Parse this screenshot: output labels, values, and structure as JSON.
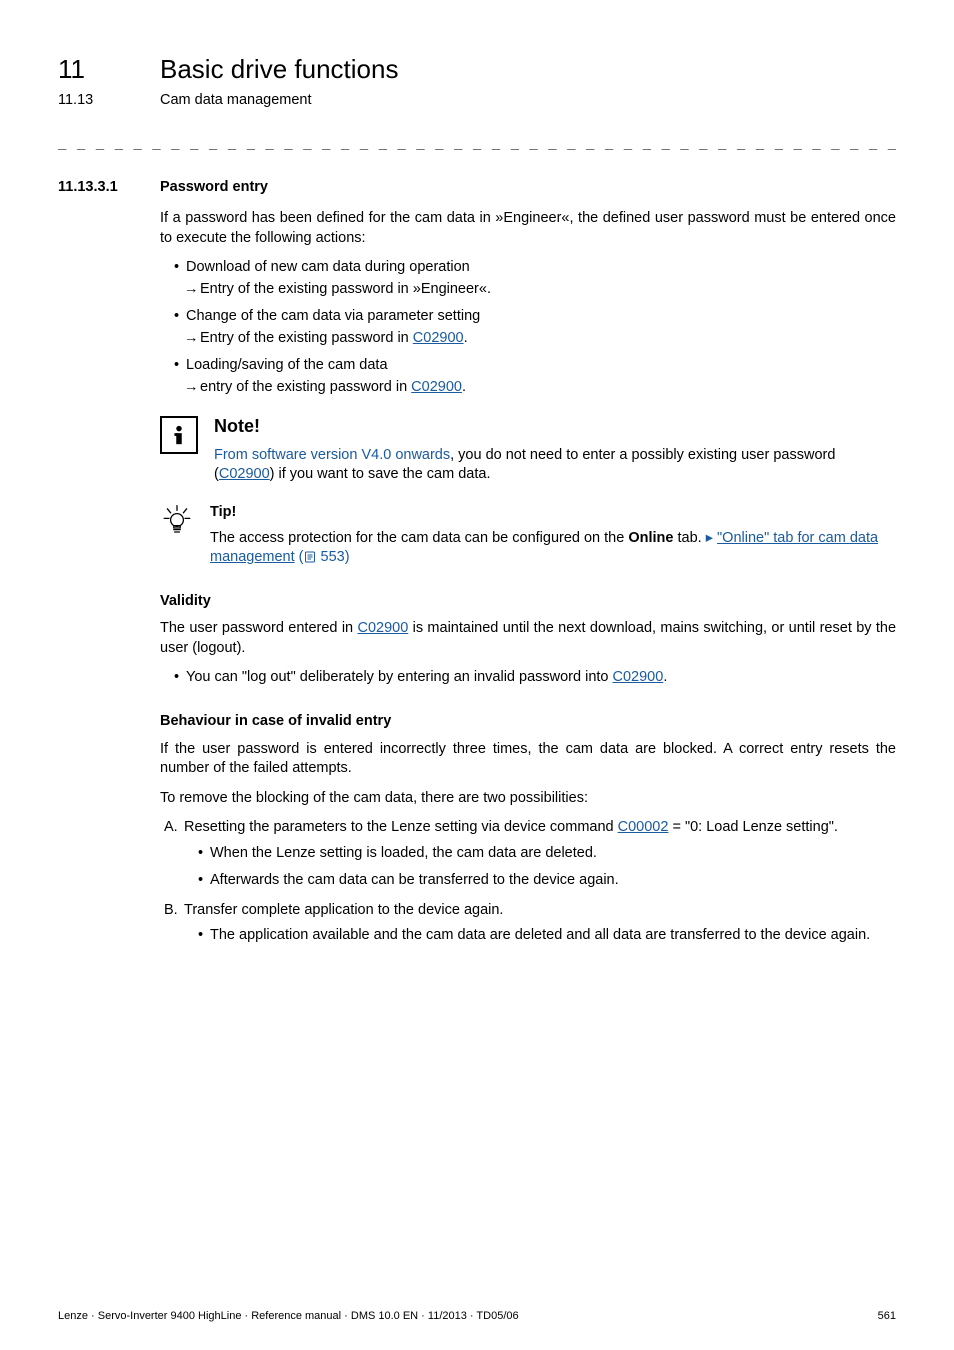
{
  "header": {
    "chapter_num": "11",
    "chapter_title": "Basic drive functions",
    "section_num": "11.13",
    "section_title": "Cam data management"
  },
  "rule": "_ _ _ _ _ _ _ _ _ _ _ _ _ _ _ _ _ _ _ _ _ _ _ _ _ _ _ _ _ _ _ _ _ _ _ _ _ _ _ _ _ _ _ _ _ _ _ _ _ _ _ _ _ _ _ _ _ _ _ _ _ _ _ _",
  "subsection": {
    "num": "11.13.3.1",
    "title": "Password entry"
  },
  "intro": "If a password has been defined for the cam data in »Engineer«, the defined user password must be entered once to execute the following actions:",
  "actions": [
    {
      "main": "Download of new cam data during operation",
      "arrow_pre": "Entry of the existing password in »Engineer«.",
      "arrow_link": null,
      "arrow_post": null
    },
    {
      "main": "Change of the cam data via parameter setting",
      "arrow_pre": "Entry of the existing password in ",
      "arrow_link": "C02900",
      "arrow_post": "."
    },
    {
      "main": "Loading/saving of the cam data",
      "arrow_pre": "entry of the existing password in ",
      "arrow_link": "C02900",
      "arrow_post": "."
    }
  ],
  "note": {
    "title": "Note!",
    "body_blue": "From software version V4.0 onwards",
    "body_rest_pre": ", you do not need to enter a possibly existing user password (",
    "body_link": "C02900",
    "body_rest_post": ") if you want to save the cam data."
  },
  "tip": {
    "title": "Tip!",
    "pre": "The access protection for the cam data can be configured on the ",
    "bold": "Online",
    "mid": " tab.  ",
    "arrow": "▸ ",
    "link": "\"Online\" tab for cam data management",
    "page_ref": " 553)",
    "page_ref_open": " ("
  },
  "validity": {
    "heading": "Validity",
    "para_pre": "The user password entered in ",
    "para_link": "C02900",
    "para_post": " is maintained until the next download, mains switching, or until reset by the user (logout).",
    "bullet_pre": "You can \"log out\" deliberately by entering an invalid password into ",
    "bullet_link": "C02900",
    "bullet_post": "."
  },
  "behaviour": {
    "heading": "Behaviour in case of invalid entry",
    "para1": "If the user password is entered incorrectly three times, the cam data are blocked. A correct entry resets the number of the failed attempts.",
    "para2": "To remove the blocking of the cam data, there are two possibilities:",
    "itemA": {
      "marker": "A.",
      "pre": "Resetting the parameters to the Lenze setting via device command ",
      "link": "C00002",
      "post": " = \"0: Load Lenze setting\".",
      "sub1": "When the Lenze setting is loaded, the cam data are deleted.",
      "sub2": "Afterwards the cam data can be transferred to the device again."
    },
    "itemB": {
      "marker": "B.",
      "text": "Transfer complete application to the device again.",
      "sub1": "The application available and the cam data are deleted and all data are transferred to the device again."
    }
  },
  "footer": {
    "left": "Lenze · Servo-Inverter 9400 HighLine · Reference manual · DMS 10.0 EN · 11/2013 · TD05/06",
    "right": "561"
  }
}
